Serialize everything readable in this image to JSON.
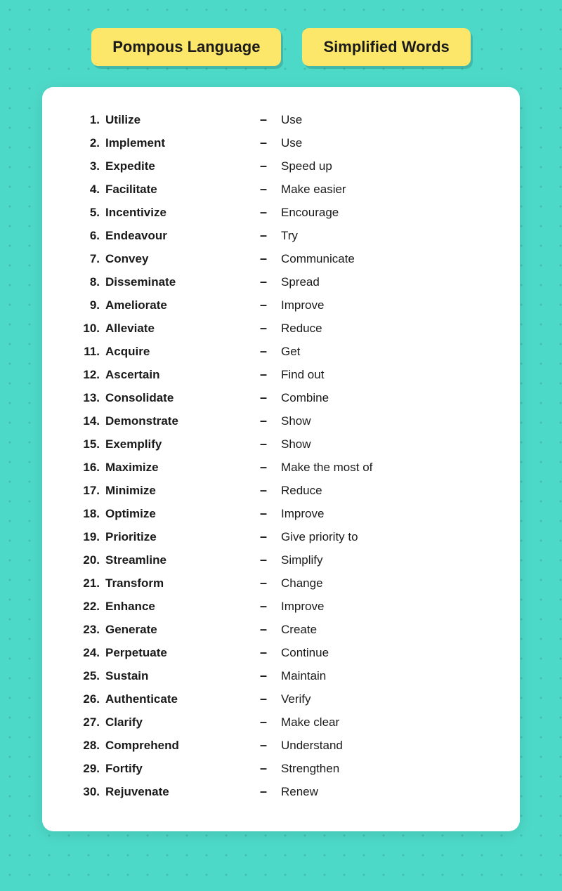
{
  "header": {
    "col1": "Pompous Language",
    "col2": "Simplified Words"
  },
  "words": [
    {
      "num": "1.",
      "pompous": "Utilize",
      "simple": "Use"
    },
    {
      "num": "2.",
      "pompous": "Implement",
      "simple": "Use"
    },
    {
      "num": "3.",
      "pompous": "Expedite",
      "simple": "Speed up"
    },
    {
      "num": "4.",
      "pompous": "Facilitate",
      "simple": "Make easier"
    },
    {
      "num": "5.",
      "pompous": "Incentivize",
      "simple": "Encourage"
    },
    {
      "num": "6.",
      "pompous": "Endeavour",
      "simple": "Try"
    },
    {
      "num": "7.",
      "pompous": "Convey",
      "simple": "Communicate"
    },
    {
      "num": "8.",
      "pompous": "Disseminate",
      "simple": "Spread"
    },
    {
      "num": "9.",
      "pompous": "Ameliorate",
      "simple": "Improve"
    },
    {
      "num": "10.",
      "pompous": "Alleviate",
      "simple": "Reduce"
    },
    {
      "num": "11.",
      "pompous": "Acquire",
      "simple": "Get"
    },
    {
      "num": "12.",
      "pompous": "Ascertain",
      "simple": "Find out"
    },
    {
      "num": "13.",
      "pompous": "Consolidate",
      "simple": "Combine"
    },
    {
      "num": "14.",
      "pompous": "Demonstrate",
      "simple": "Show"
    },
    {
      "num": "15.",
      "pompous": "Exemplify",
      "simple": "Show"
    },
    {
      "num": "16.",
      "pompous": "Maximize",
      "simple": "Make the most of"
    },
    {
      "num": "17.",
      "pompous": "Minimize",
      "simple": "Reduce"
    },
    {
      "num": "18.",
      "pompous": "Optimize",
      "simple": "Improve"
    },
    {
      "num": "19.",
      "pompous": "Prioritize",
      "simple": "Give priority to"
    },
    {
      "num": "20.",
      "pompous": "Streamline",
      "simple": "Simplify"
    },
    {
      "num": "21.",
      "pompous": "Transform",
      "simple": "Change"
    },
    {
      "num": "22.",
      "pompous": "Enhance",
      "simple": "Improve"
    },
    {
      "num": "23.",
      "pompous": "Generate",
      "simple": "Create"
    },
    {
      "num": "24.",
      "pompous": "Perpetuate",
      "simple": "Continue"
    },
    {
      "num": "25.",
      "pompous": "Sustain",
      "simple": "Maintain"
    },
    {
      "num": "26.",
      "pompous": "Authenticate",
      "simple": "Verify"
    },
    {
      "num": "27.",
      "pompous": "Clarify",
      "simple": "Make clear"
    },
    {
      "num": "28.",
      "pompous": "Comprehend",
      "simple": "Understand"
    },
    {
      "num": "29.",
      "pompous": "Fortify",
      "simple": "Strengthen"
    },
    {
      "num": "30.",
      "pompous": "Rejuvenate",
      "simple": "Renew"
    }
  ]
}
